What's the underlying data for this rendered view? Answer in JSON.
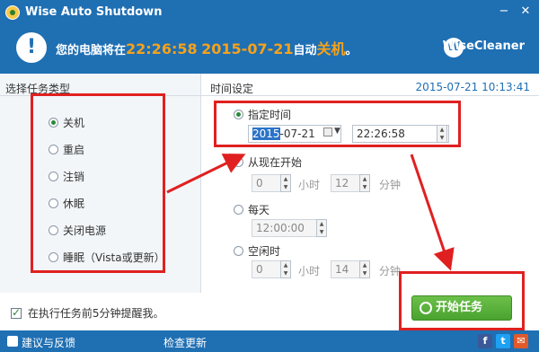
{
  "titlebar": {
    "title": "Wise Auto Shutdown",
    "minimize": "−",
    "close": "✕"
  },
  "header": {
    "msg_prefix": "您的电脑将在",
    "time": "22:26:58",
    "date": "2015-07-21",
    "msg_mid": "自动",
    "action": "关机",
    "msg_suffix": "。",
    "brand": "WiseCleaner",
    "brand_logo": "W"
  },
  "left": {
    "section_title": "选择任务类型",
    "tasks": [
      {
        "label": "关机",
        "selected": true
      },
      {
        "label": "重启",
        "selected": false
      },
      {
        "label": "注销",
        "selected": false
      },
      {
        "label": "休眠",
        "selected": false
      },
      {
        "label": "关闭电源",
        "selected": false
      },
      {
        "label": "睡眠（Vista或更新）",
        "selected": false
      }
    ],
    "reminder": "在执行任务前5分钟提醒我。"
  },
  "right": {
    "section_title": "时间设定",
    "current_datetime": "2015-07-21 10:13:41",
    "specific": {
      "label": "指定时间",
      "date_highlight": "2015",
      "date_rest": "-07-21",
      "time": "22:26:58"
    },
    "from_now": {
      "label": "从现在开始",
      "hours": "0",
      "hours_unit": "小时",
      "minutes": "12",
      "minutes_unit": "分钟"
    },
    "daily": {
      "label": "每天",
      "time": "12:00:00"
    },
    "idle": {
      "label": "空闲时",
      "hours": "0",
      "hours_unit": "小时",
      "minutes": "14",
      "minutes_unit": "分钟"
    }
  },
  "start_button": "开始任务",
  "footer": {
    "feedback": "建议与反馈",
    "update": "检查更新",
    "social": [
      "f",
      "t",
      "✉"
    ]
  },
  "colors": {
    "brand_blue": "#1f6fb3",
    "accent_orange": "#f6a21a",
    "start_green": "#5ab43c",
    "annotation_red": "#e02020"
  }
}
